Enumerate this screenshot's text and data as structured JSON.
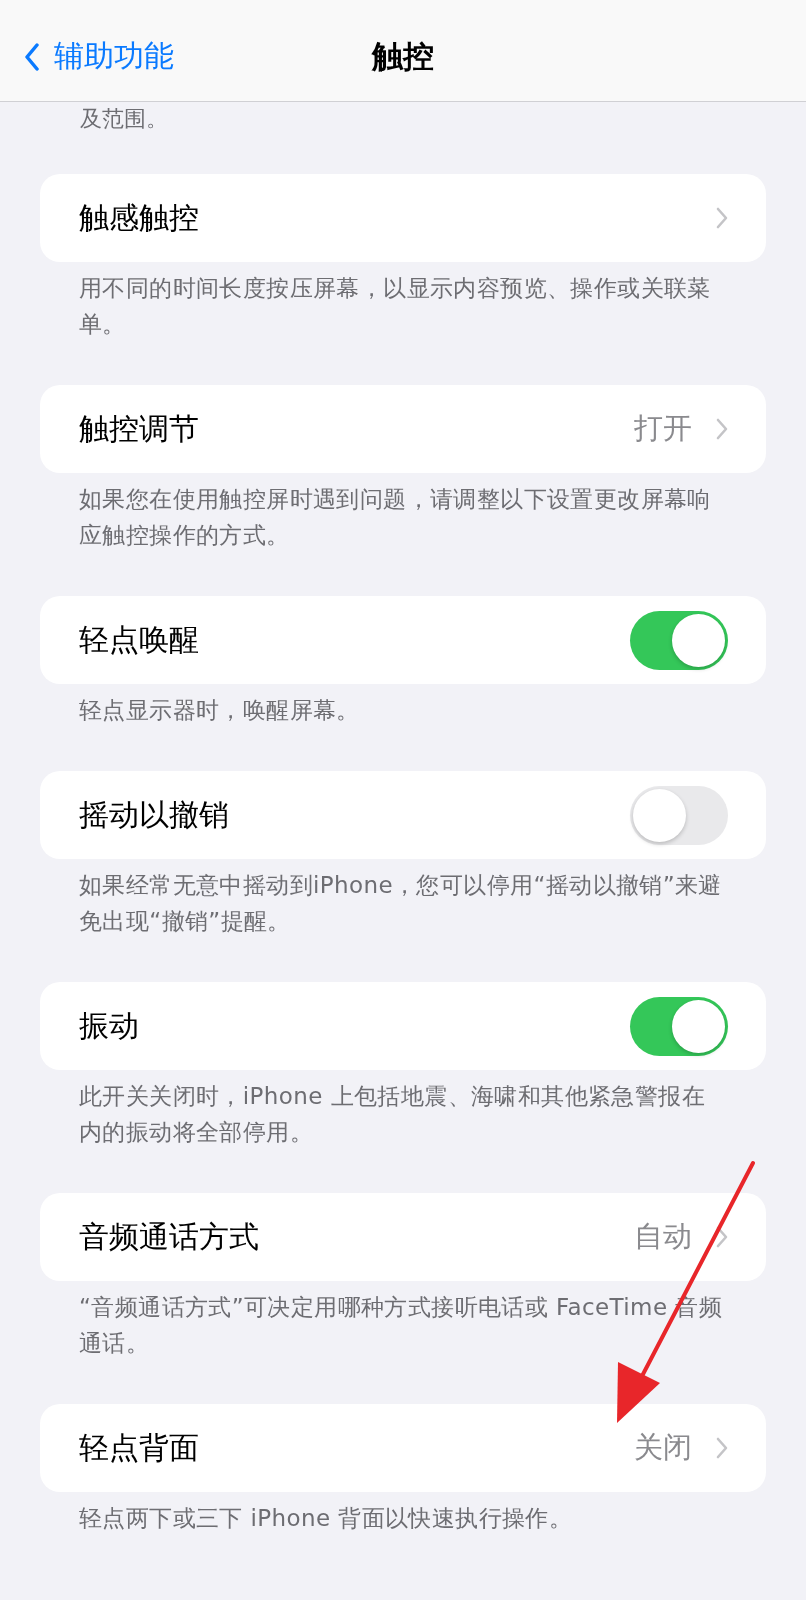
{
  "nav": {
    "back": "辅助功能",
    "title": "触控"
  },
  "top_note": "及范围。",
  "sections": [
    {
      "kind": "link",
      "label": "触感触控",
      "footer": "用不同的时间长度按压屏幕，以显示内容预览、操作或关联菜单。"
    },
    {
      "kind": "link",
      "label": "触控调节",
      "value": "打开",
      "footer": "如果您在使用触控屏时遇到问题，请调整以下设置更改屏幕响应触控操作的方式。"
    },
    {
      "kind": "toggle",
      "label": "轻点唤醒",
      "on": true,
      "footer": "轻点显示器时，唤醒屏幕。"
    },
    {
      "kind": "toggle",
      "label": "摇动以撤销",
      "on": false,
      "footer": "如果经常无意中摇动到iPhone，您可以停用“摇动以撤销”来避免出现“撤销”提醒。"
    },
    {
      "kind": "toggle",
      "label": "振动",
      "on": true,
      "footer": "此开关关闭时，iPhone 上包括地震、海啸和其他紧急警报在内的振动将全部停用。"
    },
    {
      "kind": "link",
      "label": "音频通话方式",
      "value": "自动",
      "footer": "“音频通话方式”可决定用哪种方式接听电话或 FaceTime 音频通话。"
    },
    {
      "kind": "link",
      "label": "轻点背面",
      "value": "关闭",
      "footer": "轻点两下或三下 iPhone 背面以快速执行操作。"
    }
  ]
}
